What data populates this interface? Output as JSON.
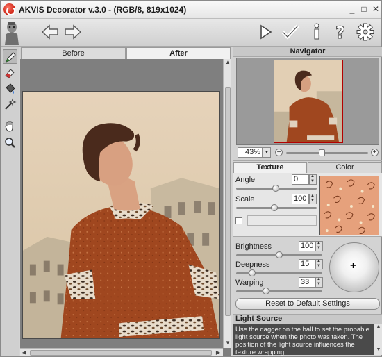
{
  "window": {
    "title": "AKVIS Decorator v.3.0 -  (RGB/8, 819x1024)",
    "minimize_glyph": "_",
    "maximize_glyph": "□",
    "close_glyph": "✕"
  },
  "toolbar": {
    "buttons": [
      "mascot-icon",
      "undo-arrow-icon",
      "redo-arrow-icon",
      "run-triangle-icon",
      "apply-checkmark-icon",
      "info-icon",
      "help-icon",
      "settings-gear-icon"
    ]
  },
  "left_tools": [
    "selection-pencil-icon",
    "eraser-icon",
    "bucket-icon",
    "magic-wand-icon",
    "hand-icon",
    "zoom-loupe-icon"
  ],
  "image_view": {
    "tabs": {
      "before": "Before",
      "after": "After"
    },
    "active_tab": "After"
  },
  "navigator": {
    "title": "Navigator",
    "zoom_value": "43%",
    "zoom_out": "−",
    "zoom_in": "+",
    "zoom_level": 0.43
  },
  "settings": {
    "tabs": {
      "texture": "Texture",
      "color": "Color"
    },
    "active_tab": "Texture",
    "angle": {
      "label": "Angle",
      "value": "0"
    },
    "scale": {
      "label": "Scale",
      "value": "100"
    },
    "brightness": {
      "label": "Brightness",
      "value": "100"
    },
    "deepness": {
      "label": "Deepness",
      "value": "15"
    },
    "warping": {
      "label": "Warping",
      "value": "33"
    },
    "reset_label": "Reset to Default Settings",
    "light_marker": "+"
  },
  "help": {
    "title": "Light Source",
    "text": "Use the dagger on the ball to set the probable light source when the photo was taken. The position of the light source influences the texture wrapping."
  },
  "colors": {
    "dress": "#a0471f",
    "pattern_bg": "#e6a17c"
  }
}
